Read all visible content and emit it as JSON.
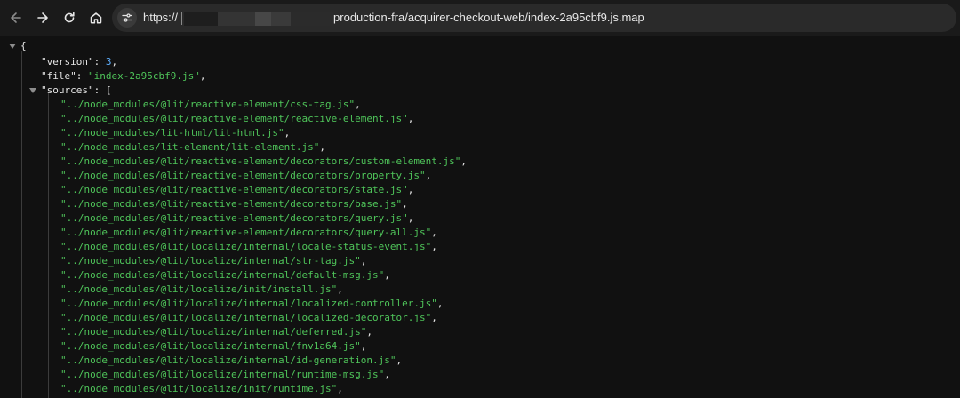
{
  "browser": {
    "url_scheme": "https://",
    "url_path": "production-fra/acquirer-checkout-web/index-2a95cbf9.js.map"
  },
  "json": {
    "open_brace": "{",
    "version_key": "\"version\"",
    "version_value": "3",
    "file_key": "\"file\"",
    "file_value": "\"index-2a95cbf9.js\"",
    "sources_key": "\"sources\"",
    "open_bracket": "[",
    "sources": [
      "\"../node_modules/@lit/reactive-element/css-tag.js\"",
      "\"../node_modules/@lit/reactive-element/reactive-element.js\"",
      "\"../node_modules/lit-html/lit-html.js\"",
      "\"../node_modules/lit-element/lit-element.js\"",
      "\"../node_modules/@lit/reactive-element/decorators/custom-element.js\"",
      "\"../node_modules/@lit/reactive-element/decorators/property.js\"",
      "\"../node_modules/@lit/reactive-element/decorators/state.js\"",
      "\"../node_modules/@lit/reactive-element/decorators/base.js\"",
      "\"../node_modules/@lit/reactive-element/decorators/query.js\"",
      "\"../node_modules/@lit/reactive-element/decorators/query-all.js\"",
      "\"../node_modules/@lit/localize/internal/locale-status-event.js\"",
      "\"../node_modules/@lit/localize/internal/str-tag.js\"",
      "\"../node_modules/@lit/localize/internal/default-msg.js\"",
      "\"../node_modules/@lit/localize/init/install.js\"",
      "\"../node_modules/@lit/localize/internal/localized-controller.js\"",
      "\"../node_modules/@lit/localize/internal/localized-decorator.js\"",
      "\"../node_modules/@lit/localize/internal/deferred.js\"",
      "\"../node_modules/@lit/localize/internal/fnv1a64.js\"",
      "\"../node_modules/@lit/localize/internal/id-generation.js\"",
      "\"../node_modules/@lit/localize/internal/runtime-msg.js\"",
      "\"../node_modules/@lit/localize/init/runtime.js\""
    ]
  },
  "colors": {
    "background": "#111111",
    "string": "#4fc55a",
    "number": "#5fb0ff",
    "key": "#e6e6e6"
  },
  "icons": [
    "back-arrow-icon",
    "forward-arrow-icon",
    "reload-icon",
    "home-icon",
    "site-settings-icon",
    "collapse-triangle-icon"
  ]
}
